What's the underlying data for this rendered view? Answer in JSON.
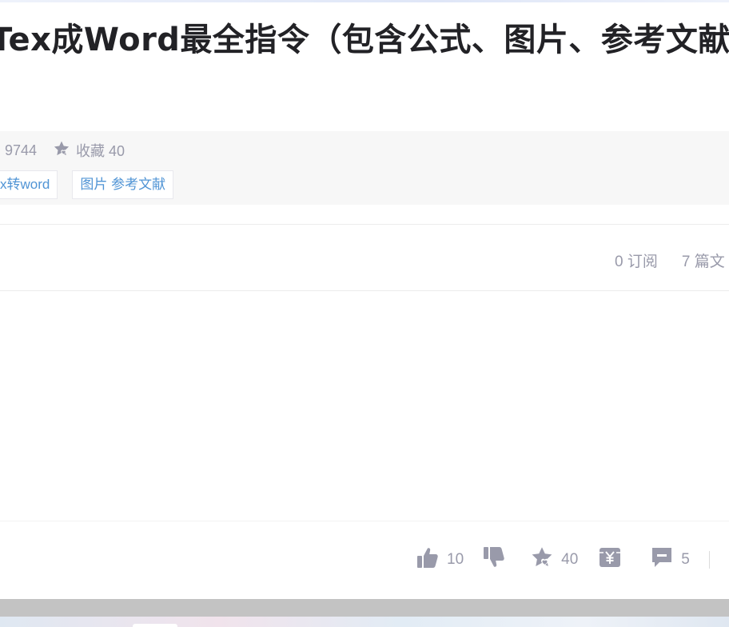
{
  "article": {
    "title": "Tex成Word最全指令（包含公式、图片、参考文献"
  },
  "meta": {
    "views": "9744",
    "favorites": "收藏 40"
  },
  "tags": [
    "x转word",
    "图片 参考文献"
  ],
  "column": {
    "subscriptions": "0 订阅",
    "articles": "7 篇文"
  },
  "toolbar": {
    "likes": "10",
    "favorites": "40",
    "comments": "5"
  },
  "icons": [
    "star-icon",
    "thumb-up-icon",
    "thumb-down-icon",
    "reward-icon",
    "comment-icon"
  ],
  "colors": {
    "icon": "#999aaa",
    "tag_text": "#5094d5",
    "title": "#222226",
    "meta_bg": "#f7f7f7"
  }
}
